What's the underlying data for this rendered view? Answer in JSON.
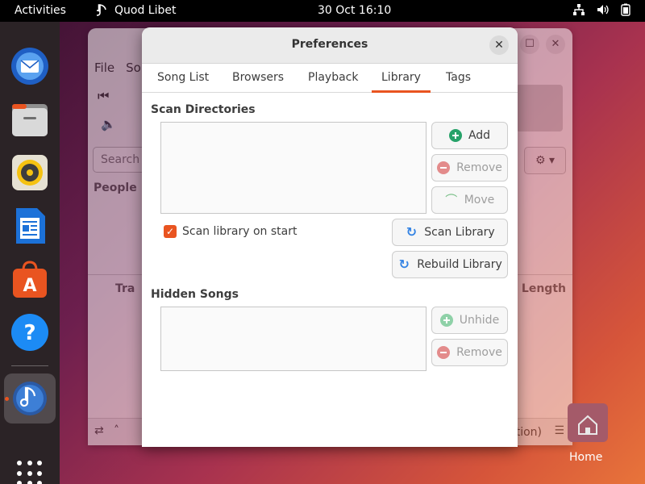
{
  "topbar": {
    "activities": "Activities",
    "app_name": "Quod Libet",
    "clock": "30 Oct  16:10",
    "tray_icons": [
      "network-icon",
      "volume-icon",
      "battery-icon"
    ]
  },
  "dock": {
    "items": [
      "thunderbird-icon",
      "files-icon",
      "rhythmbox-icon",
      "writer-icon",
      "software-icon",
      "help-icon",
      "quodlibet-icon"
    ],
    "apps_grid": "show-apps-icon"
  },
  "background_window": {
    "menu": [
      "File",
      "So"
    ],
    "search_placeholder": "Search",
    "people": "People",
    "col_track": "Tra",
    "col_length": "Length",
    "status_fragment": "tion)"
  },
  "desktop": {
    "home_label": "Home"
  },
  "dialog": {
    "title": "Preferences",
    "tabs": [
      "Song List",
      "Browsers",
      "Playback",
      "Library",
      "Tags"
    ],
    "active_tab": "Library",
    "scan": {
      "title": "Scan Directories",
      "add": "Add",
      "remove": "Remove",
      "move": "Move",
      "scan_on_start": "Scan library on start",
      "scan_library": "Scan Library",
      "rebuild_library": "Rebuild Library"
    },
    "hidden": {
      "title": "Hidden Songs",
      "unhide": "Unhide",
      "remove": "Remove"
    }
  },
  "colors": {
    "accent": "#e95420",
    "add_green": "#26a269",
    "refresh_blue": "#3584e4"
  }
}
